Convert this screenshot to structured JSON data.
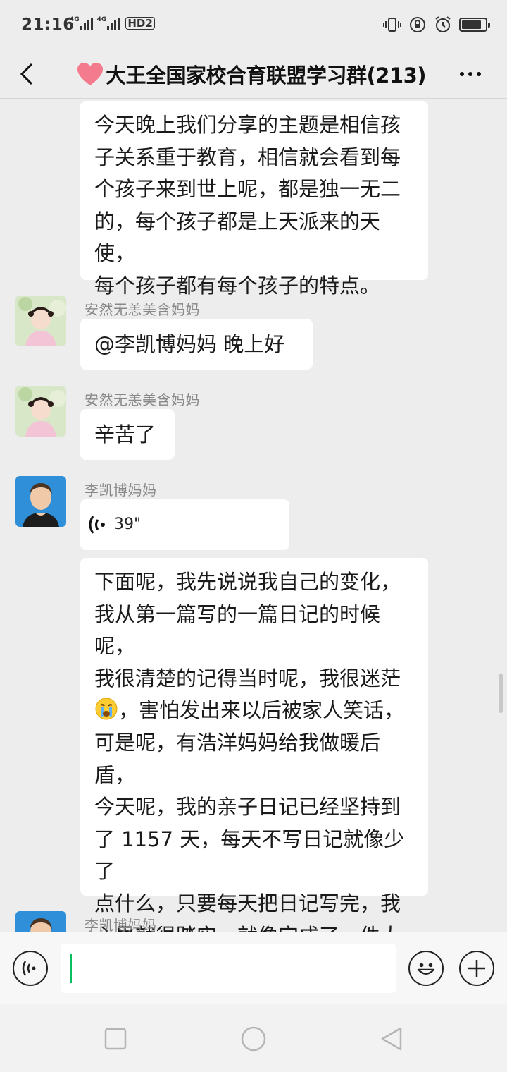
{
  "status_bar": {
    "time": "21:16",
    "network_1": "4G",
    "network_2": "4G",
    "hd_badge": "HD2",
    "battery_level": 0.85
  },
  "nav": {
    "title": "大王全国家校合育联盟学习群(213)",
    "title_icon": "heart-emoji",
    "back_icon": "chevron-left-icon",
    "more_icon": "more-dots-icon"
  },
  "messages": [
    {
      "type": "text",
      "sender": "",
      "text": "今天晚上我们分享的主题是相信孩\n子关系重于教育，相信就会看到每\n个孩子来到世上呢，都是独一无二\n的，每个孩子都是上天派来的天使，\n每个孩子都有每个孩子的特点。"
    },
    {
      "type": "text",
      "sender": "安然无恙美含妈妈",
      "text": "@李凯博妈妈  晚上好"
    },
    {
      "type": "text",
      "sender": "安然无恙美含妈妈",
      "text": "辛苦了"
    },
    {
      "type": "voice",
      "sender": "李凯博妈妈",
      "duration": "39\""
    },
    {
      "type": "text",
      "sender": "",
      "text_before_emoji": "下面呢，我先说说我自己的变化，\n我从第一篇写的一篇日记的时候呢，\n我很清楚的记得当时呢，我很迷茫\n",
      "emoji": "crying-face-emoji",
      "text_after_emoji": "，害怕发出来以后被家人笑话，\n可是呢，有浩洋妈妈给我做暖后盾，\n今天呢，我的亲子日记已经坚持到\n了 1157 天，每天不写日记就像少了\n点什么，只要每天把日记写完，我\n心里就很踏实，就像完成了一件大\n工程，心里那个高兴就不用提了。"
    },
    {
      "type": "partial",
      "sender": "李凯博妈妈"
    }
  ],
  "input_bar": {
    "voice_icon": "voice-input-icon",
    "input_value": "",
    "emoji_icon": "smiley-icon",
    "add_icon": "plus-icon"
  },
  "system_nav": {
    "recents_icon": "square-icon",
    "home_icon": "circle-icon",
    "back_icon": "triangle-back-icon"
  },
  "colors": {
    "background": "#ededed",
    "bubble": "#ffffff",
    "sender_name": "#888888",
    "caret": "#07c160"
  }
}
